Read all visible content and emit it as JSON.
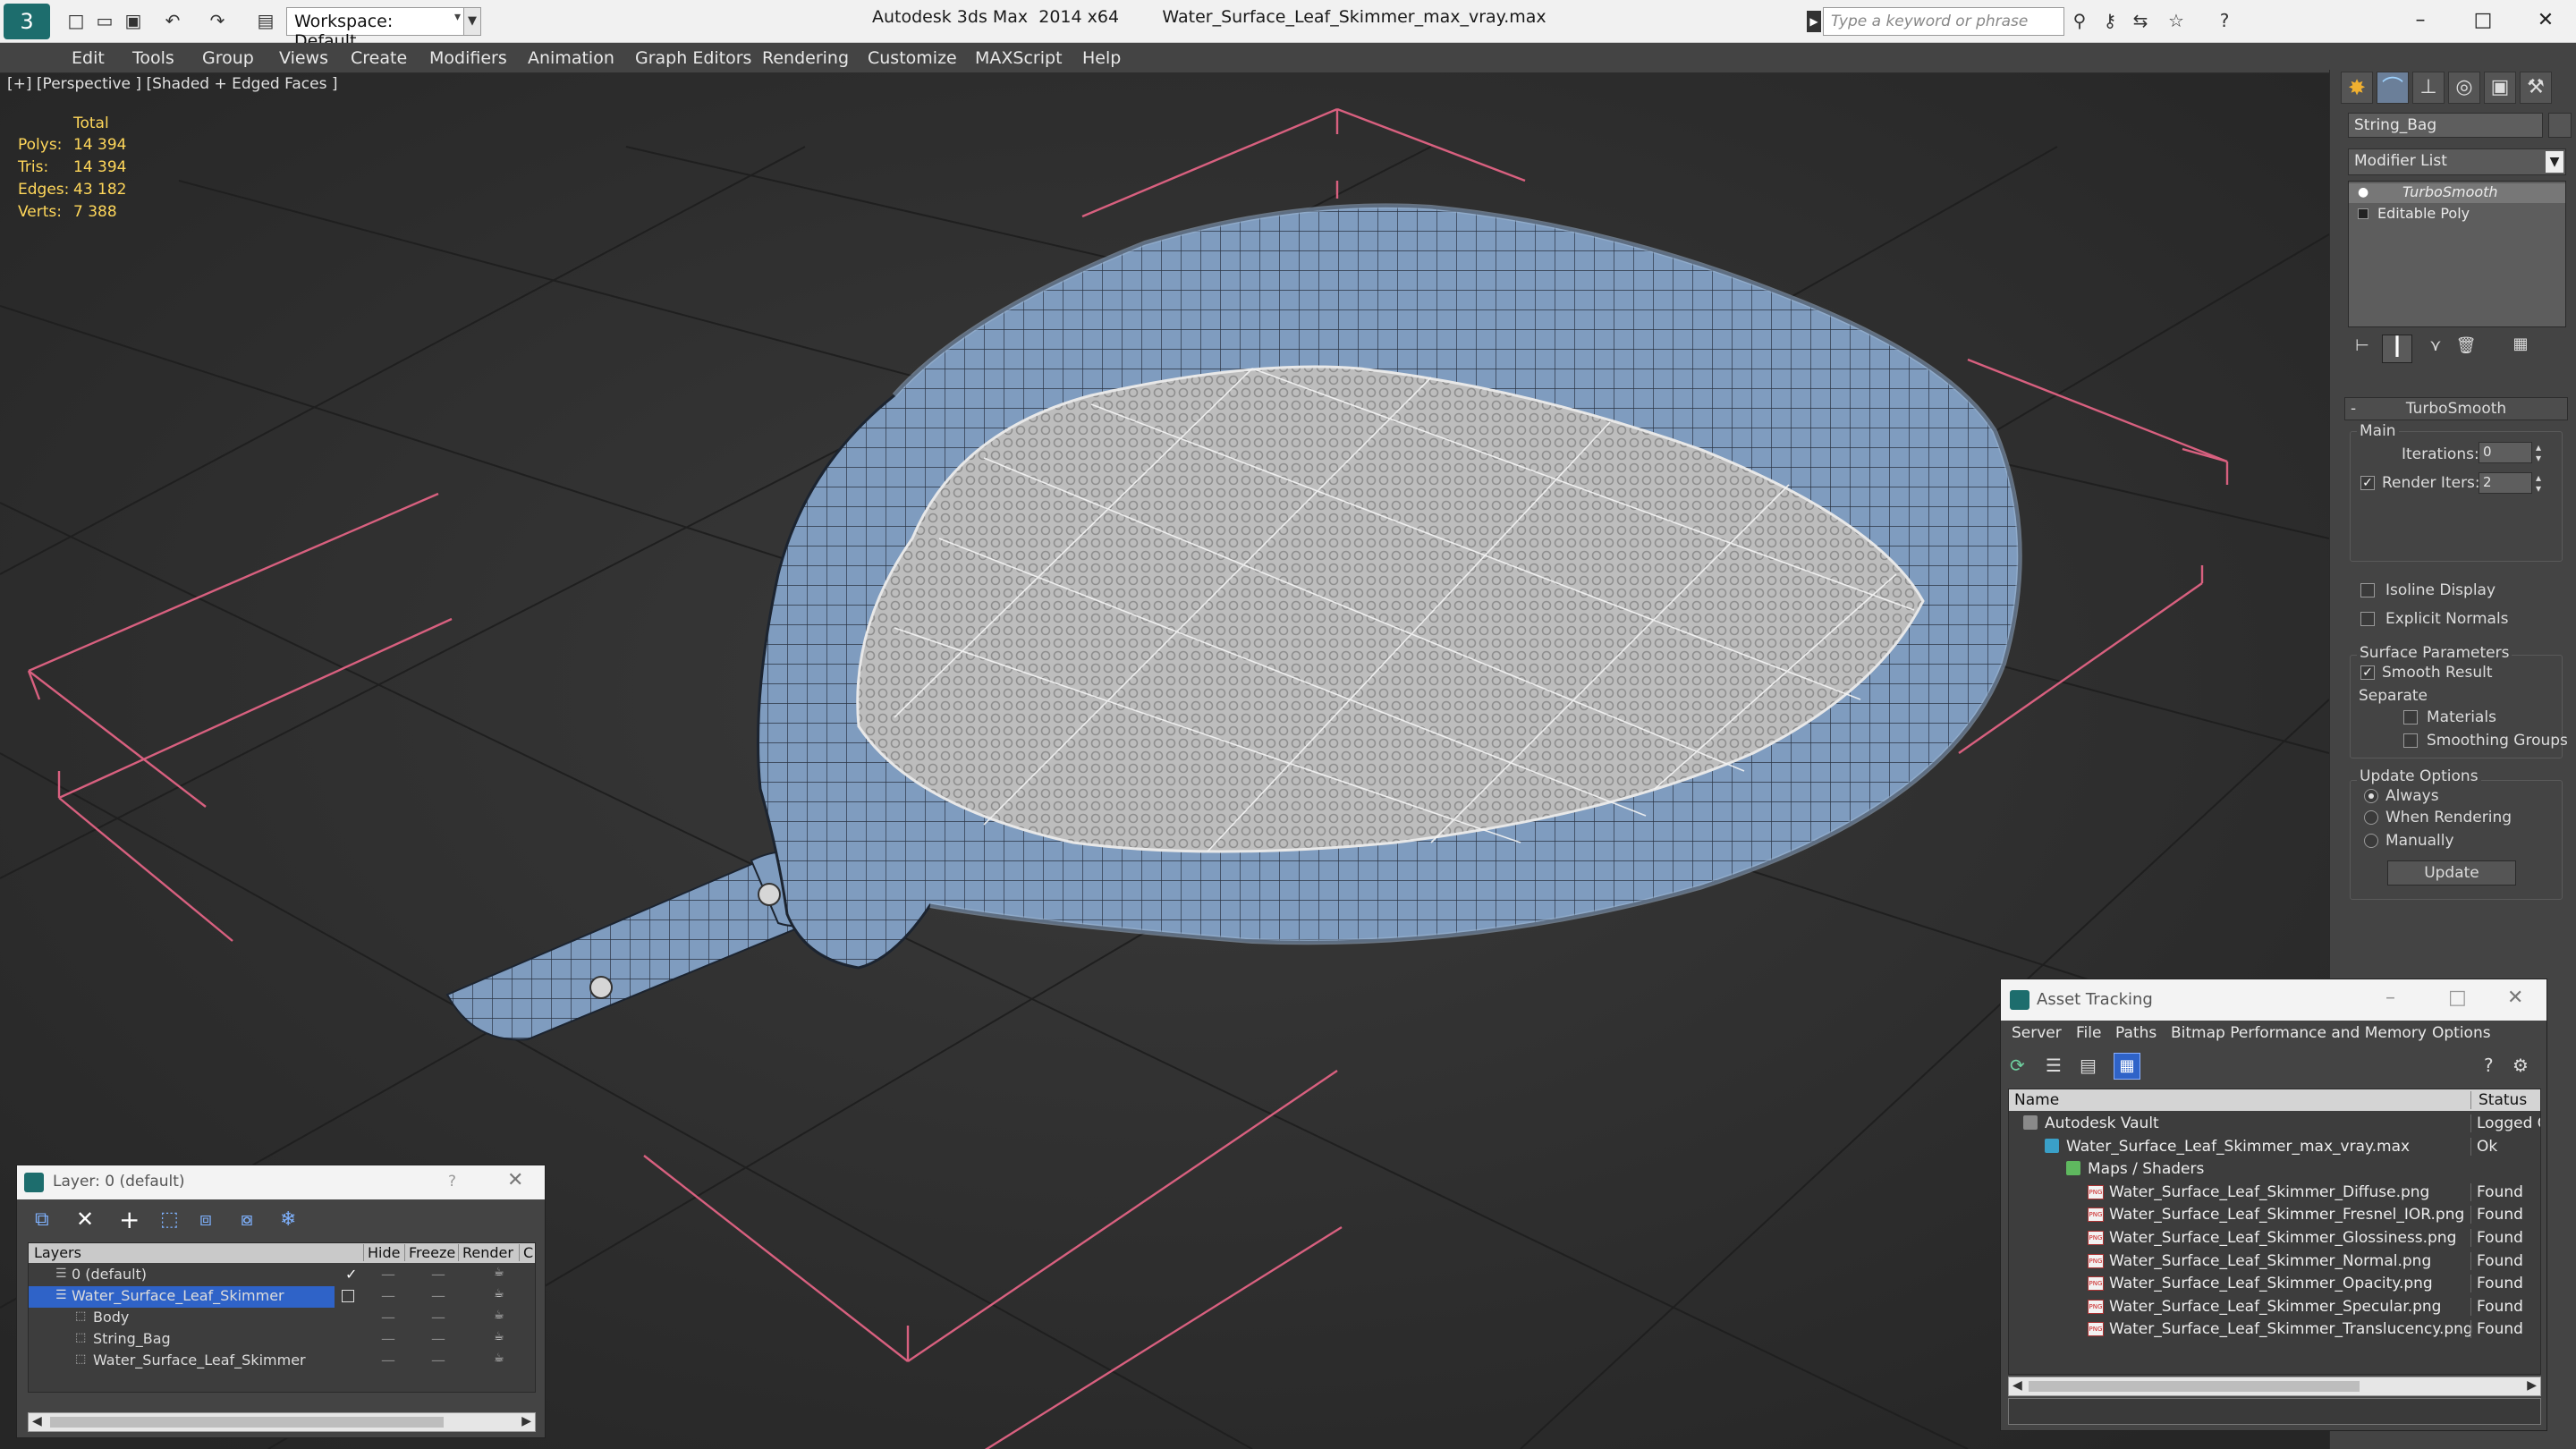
{
  "titlebar": {
    "app": "Autodesk 3ds Max  2014 x64",
    "file": "Water_Surface_Leaf_Skimmer_max_vray.max",
    "workspace": "Workspace: Default",
    "search_placeholder": "Type a keyword or phrase"
  },
  "menubar": [
    "Edit",
    "Tools",
    "Group",
    "Views",
    "Create",
    "Modifiers",
    "Animation",
    "Graph Editors",
    "Rendering",
    "Customize",
    "MAXScript",
    "Help"
  ],
  "viewport": {
    "label": "[+] [Perspective ] [Shaded + Edged Faces ]",
    "stats": {
      "header": "Total",
      "rows": [
        {
          "k": "Polys:",
          "v": "14 394"
        },
        {
          "k": "Tris:",
          "v": "14 394"
        },
        {
          "k": "Edges:",
          "v": "43 182"
        },
        {
          "k": "Verts:",
          "v": "7 388"
        }
      ]
    }
  },
  "command_panel": {
    "object_name": "String_Bag",
    "modifier_list": "Modifier List",
    "stack": [
      "TurboSmooth",
      "Editable Poly"
    ],
    "rollout_title": "TurboSmooth",
    "main_label": "Main",
    "iterations_label": "Iterations:",
    "iterations_value": "0",
    "render_iters_label": "Render Iters:",
    "render_iters_value": "2",
    "render_iters_checked": true,
    "isoline_label": "Isoline Display",
    "explicit_label": "Explicit Normals",
    "surface_label": "Surface Parameters",
    "smooth_label": "Smooth Result",
    "separate_label": "Separate",
    "materials_label": "Materials",
    "smoothing_label": "Smoothing Groups",
    "update_options_label": "Update Options",
    "always_label": "Always",
    "when_rendering_label": "When Rendering",
    "manually_label": "Manually",
    "update_button": "Update"
  },
  "layer_window": {
    "title": "Layer: 0 (default)",
    "help": "?",
    "columns": [
      "Layers",
      "Hide",
      "Freeze",
      "Render",
      "C"
    ],
    "rows": [
      {
        "name": "0 (default)",
        "indent": 0,
        "selected": false
      },
      {
        "name": "Water_Surface_Leaf_Skimmer",
        "indent": 0,
        "selected": true
      },
      {
        "name": "Body",
        "indent": 1,
        "selected": false
      },
      {
        "name": "String_Bag",
        "indent": 1,
        "selected": false
      },
      {
        "name": "Water_Surface_Leaf_Skimmer",
        "indent": 1,
        "selected": false
      }
    ]
  },
  "asset_tracking": {
    "title": "Asset Tracking",
    "menu": [
      "Server",
      "File",
      "Paths",
      "Bitmap Performance and Memory",
      "Options"
    ],
    "columns": [
      "Name",
      "Status"
    ],
    "rows": [
      {
        "name": "Autodesk Vault",
        "status": "Logged C",
        "indent": 0,
        "icon": "vault-icon"
      },
      {
        "name": "Water_Surface_Leaf_Skimmer_max_vray.max",
        "status": "Ok",
        "indent": 1,
        "icon": "max-file-icon"
      },
      {
        "name": "Maps / Shaders",
        "status": "",
        "indent": 2,
        "icon": "maps-icon"
      },
      {
        "name": "Water_Surface_Leaf_Skimmer_Diffuse.png",
        "status": "Found",
        "indent": 3,
        "icon": "png-icon"
      },
      {
        "name": "Water_Surface_Leaf_Skimmer_Fresnel_IOR.png",
        "status": "Found",
        "indent": 3,
        "icon": "png-icon"
      },
      {
        "name": "Water_Surface_Leaf_Skimmer_Glossiness.png",
        "status": "Found",
        "indent": 3,
        "icon": "png-icon"
      },
      {
        "name": "Water_Surface_Leaf_Skimmer_Normal.png",
        "status": "Found",
        "indent": 3,
        "icon": "png-icon"
      },
      {
        "name": "Water_Surface_Leaf_Skimmer_Opacity.png",
        "status": "Found",
        "indent": 3,
        "icon": "png-icon"
      },
      {
        "name": "Water_Surface_Leaf_Skimmer_Specular.png",
        "status": "Found",
        "indent": 3,
        "icon": "png-icon"
      },
      {
        "name": "Water_Surface_Leaf_Skimmer_Translucency.png",
        "status": "Found",
        "indent": 3,
        "icon": "png-icon"
      }
    ]
  },
  "colors": {
    "model_blue": "#7f9cbf",
    "net_white": "#cfcfcf",
    "grid_pink": "#d8607f",
    "stat_yellow": "#ffd75a",
    "select_blue": "#2f63c8"
  }
}
